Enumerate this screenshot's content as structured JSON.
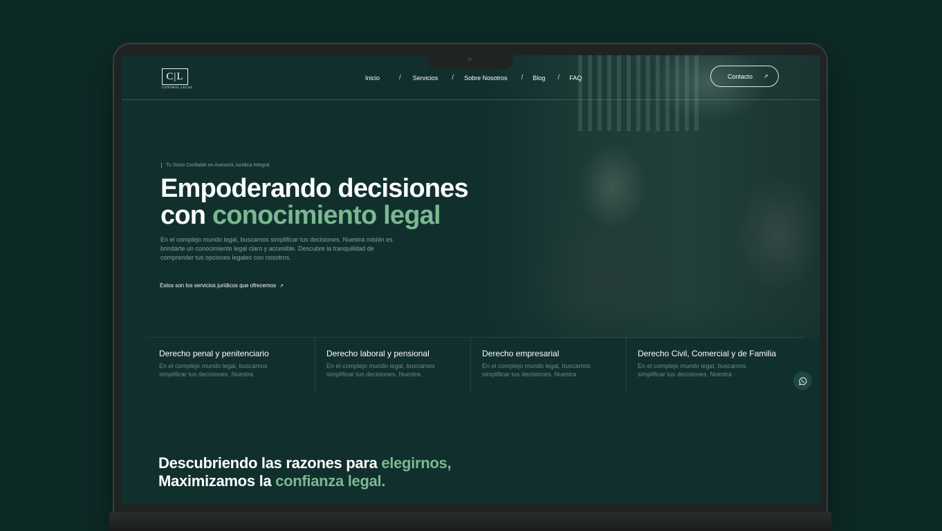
{
  "brand": {
    "logo_mark": "C|L",
    "logo_text": "CONTROL LEGAL"
  },
  "nav": {
    "items": [
      "Inicio",
      "Servicios",
      "Sobre Nosotros",
      "Blog",
      "FAQ"
    ],
    "separator": "/",
    "contact_label": "Contacto",
    "contact_icon": "arrow-up-right-icon"
  },
  "hero": {
    "tagline": "Tu Socio Confiable en Asesoría Jurídica Integral",
    "headline_line1": "Empoderando decisiones",
    "headline_line2_plain": "con",
    "headline_line2_accent": "conocimiento legal",
    "intro": "En el complejo mundo legal, buscamos simplificar tus decisiones. Nuestra misión es brindarte un conocimiento legal claro y accesible. Descubre la tranquilidad de comprender tus opciones legales con nosotros.",
    "services_link": "Estos son los servicios jurídicos que ofrecemos"
  },
  "services": [
    {
      "title": "Derecho penal y penitenciario",
      "desc": "En el complejo mundo legal, buscamos simplificar tus decisiones. Nuestra"
    },
    {
      "title": "Derecho laboral y pensional",
      "desc": "En el complejo mundo legal, buscamos simplificar tus decisiones. Nuestra"
    },
    {
      "title": "Derecho empresarial",
      "desc": "En el complejo mundo legal, buscamos simplificar tus decisiones. Nuestra"
    },
    {
      "title": "Derecho Civil, Comercial y de Familia",
      "desc": "En el complejo mundo legal, buscamos simplificar tus decisiones. Nuestra"
    }
  ],
  "section2": {
    "line1_plain": "Descubriendo las razones para",
    "line1_accent": "elegirnos,",
    "line2_plain": "Maximizamos la",
    "line2_accent": "confianza legal."
  },
  "colors": {
    "background": "#0d2a27",
    "screen": "#11302d",
    "accent": "#7bb891"
  }
}
